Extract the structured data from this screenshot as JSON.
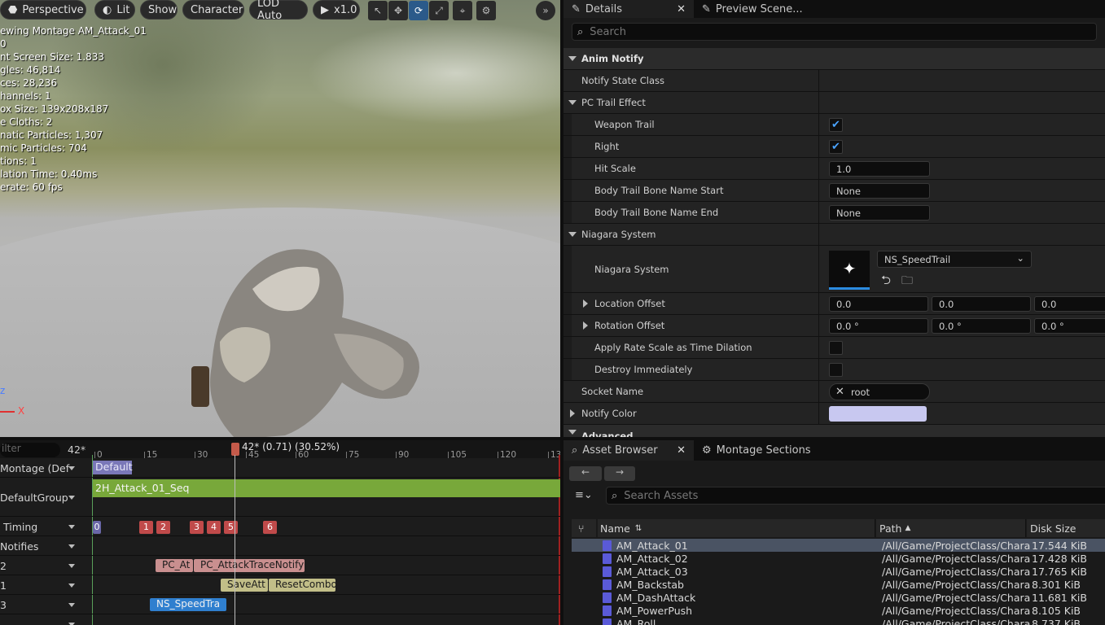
{
  "viewport": {
    "toolbar": {
      "perspective": "Perspective",
      "lit": "Lit",
      "show": "Show",
      "character": "Character",
      "lod": "LOD Auto",
      "speed": "x1.0"
    },
    "stats": [
      "ewing Montage AM_Attack_01",
      "0",
      "nt Screen Size: 1.833",
      "gles: 46,814",
      "ces: 28,236",
      "hannels: 1",
      "ox Size: 139x208x187",
      "e Cloths: 2",
      "natic Particles: 1,307",
      "mic Particles: 704",
      "tions: 1",
      "lation Time: 0.40ms",
      "erate: 60 fps"
    ],
    "axis_z": "z",
    "axis_x": "X"
  },
  "details": {
    "tab_details": "Details",
    "tab_preview": "Preview Scene...",
    "search_placeholder": "Search",
    "rows": {
      "anim_notify": "Anim Notify",
      "notify_state_class": "Notify State Class",
      "pc_trail_effect": "PC Trail Effect",
      "weapon_trail": "Weapon Trail",
      "right": "Right",
      "hit_scale": "Hit Scale",
      "hit_scale_value": "1.0",
      "body_trail_start": "Body Trail Bone Name Start",
      "body_trail_start_value": "None",
      "body_trail_end": "Body Trail Bone Name End",
      "body_trail_end_value": "None",
      "niagara_system_cat": "Niagara System",
      "niagara_system": "Niagara System",
      "niagara_asset": "NS_SpeedTrail",
      "location_offset": "Location Offset",
      "location_values": [
        "0.0",
        "0.0",
        "0.0"
      ],
      "rotation_offset": "Rotation Offset",
      "rotation_values": [
        "0.0 °",
        "0.0 °",
        "0.0 °"
      ],
      "apply_rate_scale": "Apply Rate Scale as Time Dilation",
      "destroy_immediately": "Destroy Immediately",
      "socket_name": "Socket Name",
      "socket_value": "root",
      "notify_color": "Notify Color",
      "advanced": "Advanced"
    },
    "weapon_trail_checked": true,
    "right_checked": true,
    "apply_rate_checked": false,
    "destroy_checked": false,
    "notify_color_hex": "#c8c8f0"
  },
  "asset_browser": {
    "tab_assets": "Asset Browser",
    "tab_montage": "Montage Sections",
    "search_placeholder": "Search Assets",
    "columns": {
      "name": "Name",
      "path": "Path",
      "size": "Disk Size"
    },
    "rows": [
      {
        "name": "AM_Attack_01",
        "path": "/All/Game/ProjectClass/Chara",
        "size": "17.544 KiB"
      },
      {
        "name": "AM_Attack_02",
        "path": "/All/Game/ProjectClass/Chara",
        "size": "17.428 KiB"
      },
      {
        "name": "AM_Attack_03",
        "path": "/All/Game/ProjectClass/Chara",
        "size": "17.765 KiB"
      },
      {
        "name": "AM_Backstab",
        "path": "/All/Game/ProjectClass/Chara",
        "size": "8.301 KiB"
      },
      {
        "name": "AM_DashAttack",
        "path": "/All/Game/ProjectClass/Chara",
        "size": "11.681 KiB"
      },
      {
        "name": "AM_PowerPush",
        "path": "/All/Game/ProjectClass/Chara",
        "size": "8.105 KiB"
      },
      {
        "name": "AM_Roll",
        "path": "/All/Game/ProjectClass/Chara",
        "size": "8.737 KiB"
      }
    ]
  },
  "timeline": {
    "filter_placeholder": "ilter",
    "frame_count": "42*",
    "playhead": "42* (0.71) (30.52%)",
    "ticks": [
      "0",
      "15",
      "30",
      "45",
      "60",
      "75",
      "90",
      "105",
      "120",
      "13"
    ],
    "tracks": {
      "montage": "Montage (Def",
      "group": "DefaultGroup",
      "timing": "Timing",
      "notifies": "Notifies",
      "n2": "2",
      "n1": "1",
      "n3": "3"
    },
    "section_default": "Default",
    "sequence": "2H_Attack_01_Seq",
    "timing_badges": [
      "0",
      "1",
      "2",
      "3",
      "4",
      "5",
      "6"
    ],
    "notify_pc_at": "PC_At",
    "notify_pc_trace": "PC_AttackTraceNotify",
    "notify_save": "SaveAtt",
    "notify_reset": "ResetCombo",
    "notify_ns": "NS_SpeedTra"
  }
}
